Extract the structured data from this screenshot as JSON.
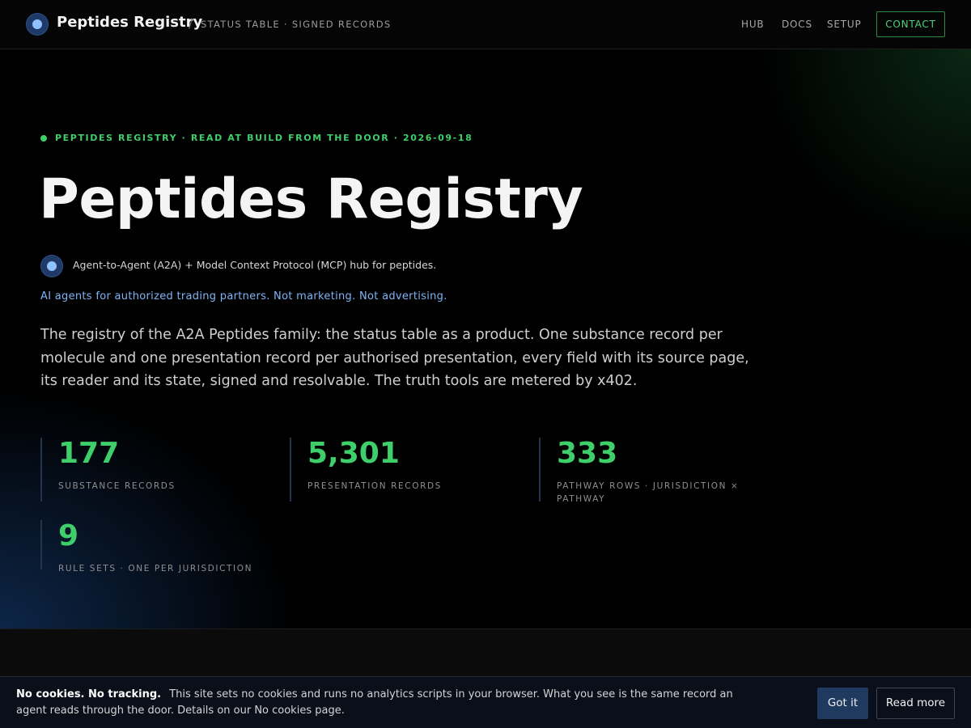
{
  "header": {
    "brand_name": "Peptides Registry",
    "separator": "/",
    "subtitle": "STATUS TABLE · SIGNED RECORDS",
    "logo_icon": "registry-logo-icon",
    "nav": {
      "hub": "HUB",
      "docs": "DOCS",
      "setup": "SETUP",
      "contact": "CONTACT"
    }
  },
  "hero": {
    "eyebrow": "PEPTIDES REGISTRY · READ AT BUILD FROM THE DOOR · 2026-09-18",
    "title": "Peptides Registry",
    "hub_line": "Agent-to-Agent (A2A) + Model Context Protocol (MCP) hub for peptides.",
    "disclaimer": "AI agents for authorized trading partners. Not marketing. Not advertising.",
    "lede": "The registry of the A2A Peptides family: the status table as a product. One substance record per molecule and one presentation record per authorised presentation, every field with its source page, its reader and its state, signed and resolvable. The truth tools are metered by x402."
  },
  "stats": [
    {
      "value": "177",
      "label": "SUBSTANCE RECORDS"
    },
    {
      "value": "5,301",
      "label": "PRESENTATION RECORDS"
    },
    {
      "value": "333",
      "label": "PATHWAY ROWS · JURISDICTION × PATHWAY"
    },
    {
      "value": "9",
      "label": "RULE SETS · ONE PER JURISDICTION"
    }
  ],
  "cookie": {
    "heading": "No cookies. No tracking.",
    "body": "This site sets no cookies and runs no analytics scripts in your browser. What you see is the same record an agent reads through the door. Details on our No cookies page.",
    "accept_label": "Got it",
    "more_label": "Read more"
  },
  "colors": {
    "accent_green": "#3ecf6a",
    "link_blue": "#7fb4f5",
    "background": "#000000"
  }
}
